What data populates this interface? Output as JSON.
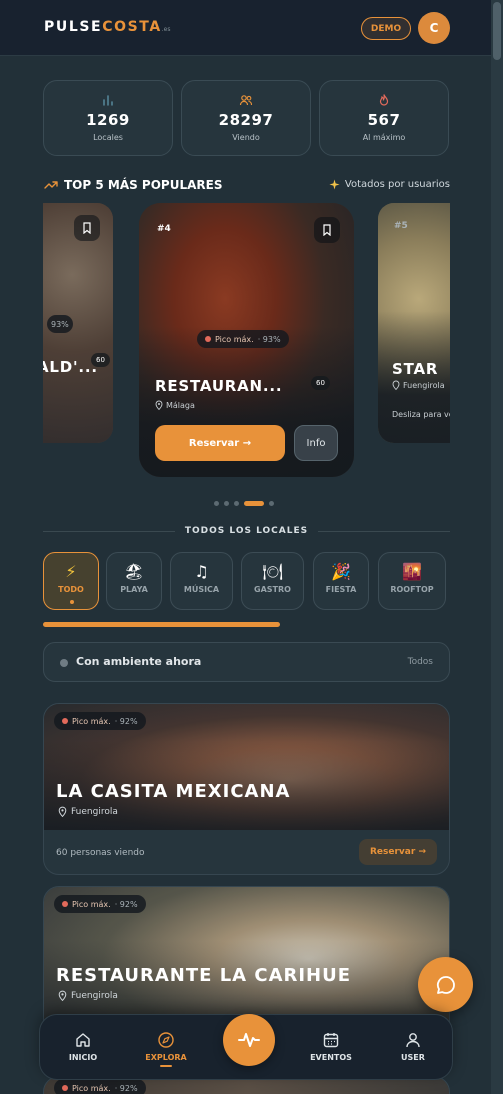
{
  "header": {
    "logo_part1": "PULSE",
    "logo_part2": "COSTA",
    "logo_suffix": ".es",
    "demo_label": "DEMO",
    "avatar_initial": "C"
  },
  "stats": [
    {
      "icon": "bar-chart-icon",
      "value": "1269",
      "label": "Locales"
    },
    {
      "icon": "users-icon",
      "value": "28297",
      "label": "Viendo"
    },
    {
      "icon": "flame-icon",
      "value": "567",
      "label": "Al máximo"
    }
  ],
  "top5": {
    "title": "TOP 5 MÁS POPULARES",
    "right_label": "Votados por usuarios",
    "cards": [
      {
        "rank": "",
        "title": "ALD'...",
        "viewers": "60",
        "pill_pct": "93%"
      },
      {
        "rank": "#4",
        "title": "RESTAURAN...",
        "location": "Málaga",
        "pill_label": "Pico máx.",
        "pill_pct": "· 93%",
        "viewers": "60",
        "reserve_label": "Reservar →",
        "info_label": "Info"
      },
      {
        "rank": "#5",
        "title": "STAR",
        "location": "Fuengirola",
        "hint": "Desliza para ve"
      }
    ],
    "dots_count": 5,
    "dots_active_index": 3
  },
  "all_venues": {
    "title": "TODOS LOS LOCALES",
    "categories": [
      {
        "icon": "lightning-icon",
        "glyph": "⚡",
        "label": "TODO",
        "active": true
      },
      {
        "icon": "beach-icon",
        "glyph": "🏖",
        "label": "PLAYA",
        "active": false
      },
      {
        "icon": "music-icon",
        "glyph": "♫",
        "label": "MÚSICA",
        "active": false
      },
      {
        "icon": "plate-icon",
        "glyph": "🍽",
        "label": "GASTRO",
        "active": false
      },
      {
        "icon": "party-icon",
        "glyph": "🎉",
        "label": "FIESTA",
        "active": false
      },
      {
        "icon": "skyline-icon",
        "glyph": "🌇",
        "label": "ROOFTOP",
        "active": false
      }
    ],
    "filter_label": "Con ambiente ahora",
    "filter_right": "Todos"
  },
  "venues": [
    {
      "pill_label": "Pico máx.",
      "pill_pct": "· 92%",
      "name": "LA CASITA MEXICANA",
      "location": "Fuengirola",
      "viewers_text": "60 personas viendo",
      "reserve_label": "Reservar →"
    },
    {
      "pill_label": "Pico máx.",
      "pill_pct": "· 92%",
      "name": "RESTAURANTE LA CARIHUE",
      "location": "Fuengirola"
    },
    {
      "pill_label": "Pico máx.",
      "pill_pct": "· 92%"
    }
  ],
  "bottom_nav": [
    {
      "icon": "home-icon",
      "label": "INICIO",
      "active": false
    },
    {
      "icon": "compass-icon",
      "label": "EXPLORA",
      "active": true
    },
    {
      "icon": "pulse-icon",
      "label": "",
      "active": false
    },
    {
      "icon": "calendar-icon",
      "label": "EVENTOS",
      "active": false
    },
    {
      "icon": "user-icon",
      "label": "USER",
      "active": false
    }
  ],
  "colors": {
    "accent": "#e8923a",
    "background": "#223038",
    "live_dot": "#e26a5b"
  }
}
